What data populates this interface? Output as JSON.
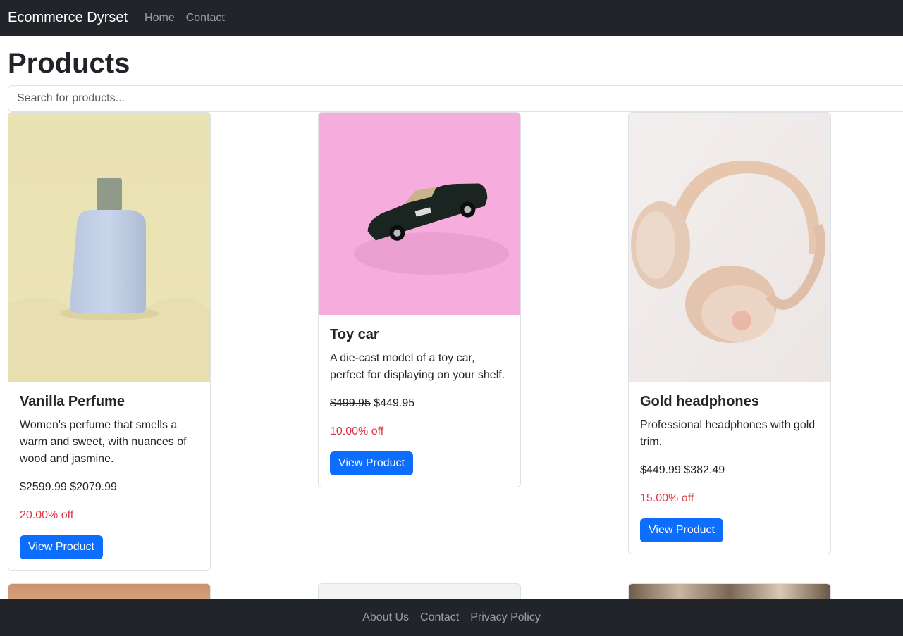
{
  "navbar": {
    "brand": "Ecommerce Dyrset",
    "links": [
      "Home",
      "Contact"
    ]
  },
  "main": {
    "title": "Products",
    "search_placeholder": "Search for products..."
  },
  "products": [
    {
      "name": "Vanilla Perfume",
      "description": "Women's perfume that smells a warm and sweet, with nuances of wood and jasmine.",
      "old_price": "$2599.99",
      "price": "$2079.99",
      "discount": "20.00% off",
      "button": "View Product"
    },
    {
      "name": "Toy car",
      "description": "A die-cast model of a toy car, perfect for displaying on your shelf.",
      "old_price": "$499.95",
      "price": "$449.95",
      "discount": "10.00% off",
      "button": "View Product"
    },
    {
      "name": "Gold headphones",
      "description": "Professional headphones with gold trim.",
      "old_price": "$449.99",
      "price": "$382.49",
      "discount": "15.00% off",
      "button": "View Product"
    }
  ],
  "footer": {
    "links": [
      "About Us",
      "Contact",
      "Privacy Policy"
    ]
  },
  "colors": {
    "navbar_bg": "#212529",
    "primary": "#0d6efd",
    "discount": "#dc3545"
  }
}
